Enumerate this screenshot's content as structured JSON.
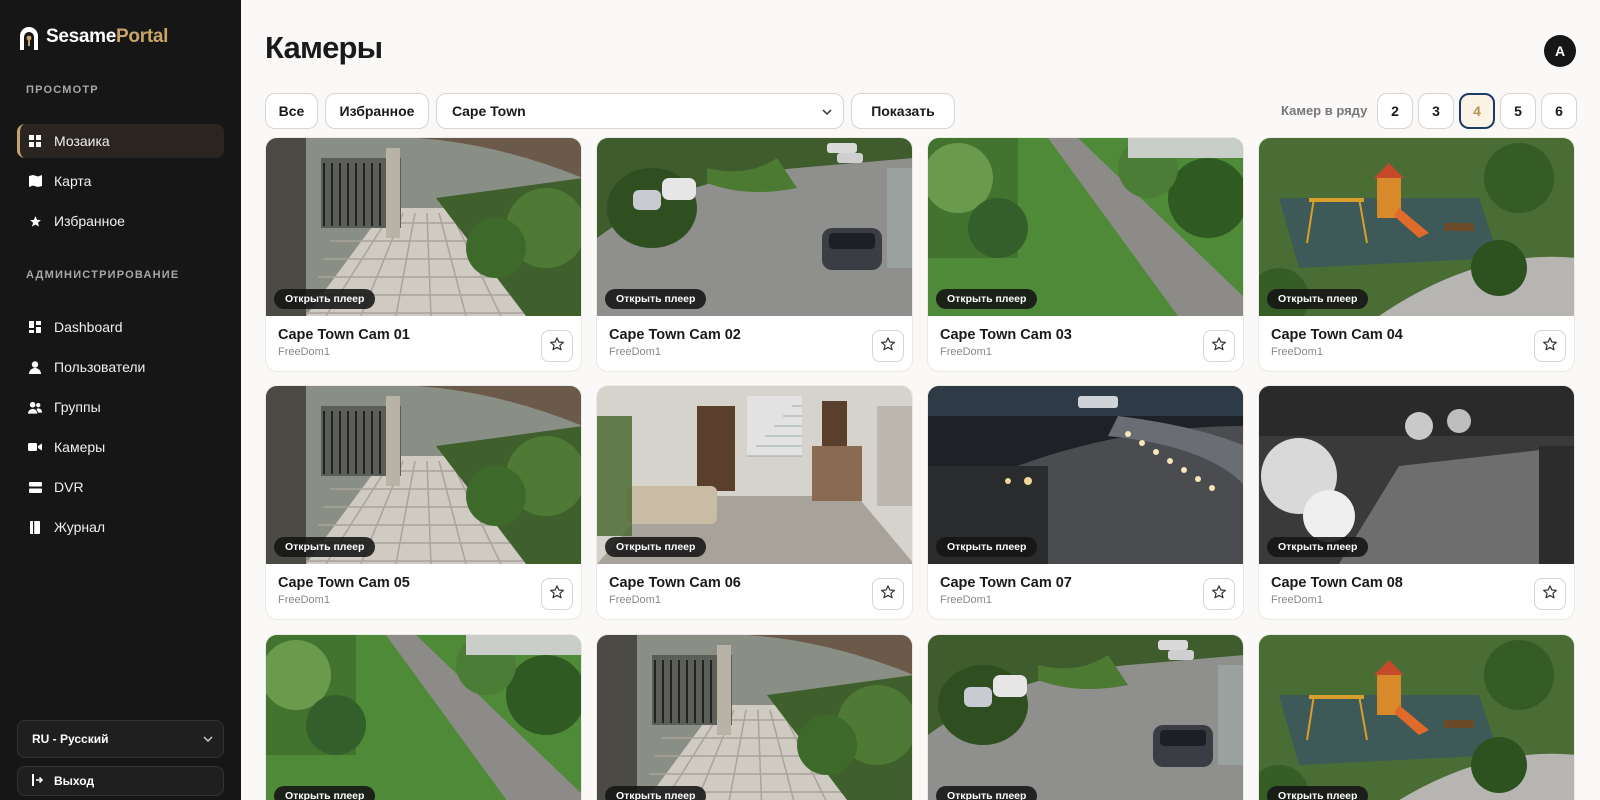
{
  "app": {
    "logo_part1": "Sesame",
    "logo_part2": "Portal"
  },
  "sidebar": {
    "view_section": "ПРОСМОТР",
    "view_items": [
      {
        "label": "Мозаика",
        "icon": "grid-icon",
        "active": true
      },
      {
        "label": "Карта",
        "icon": "map-icon",
        "active": false
      },
      {
        "label": "Избранное",
        "icon": "star-icon",
        "active": false
      }
    ],
    "admin_section": "АДМИНИСТРИРОВАНИЕ",
    "admin_items": [
      {
        "label": "Dashboard",
        "icon": "dashboard-icon"
      },
      {
        "label": "Пользователи",
        "icon": "user-icon"
      },
      {
        "label": "Группы",
        "icon": "users-icon"
      },
      {
        "label": "Камеры",
        "icon": "camera-icon"
      },
      {
        "label": "DVR",
        "icon": "dvr-icon"
      },
      {
        "label": "Журнал",
        "icon": "journal-icon"
      }
    ],
    "language": "RU - Русский",
    "logout": "Выход"
  },
  "header": {
    "title": "Камеры",
    "avatar_letter": "A"
  },
  "filters": {
    "all_label": "Все",
    "favorites_label": "Избранное",
    "city_selected": "Cape Town",
    "show_label": "Показать",
    "per_row_label": "Камер в ряду",
    "per_row_options": [
      "2",
      "3",
      "4",
      "5",
      "6"
    ],
    "per_row_selected": "4"
  },
  "cameras": {
    "open_player_label": "Открыть плеер",
    "items": [
      {
        "name": "Cape Town Cam 01",
        "owner": "FreeDom1",
        "scene": "gate"
      },
      {
        "name": "Cape Town Cam 02",
        "owner": "FreeDom1",
        "scene": "parking"
      },
      {
        "name": "Cape Town Cam 03",
        "owner": "FreeDom1",
        "scene": "path"
      },
      {
        "name": "Cape Town Cam 04",
        "owner": "FreeDom1",
        "scene": "playground"
      },
      {
        "name": "Cape Town Cam 05",
        "owner": "FreeDom1",
        "scene": "gate"
      },
      {
        "name": "Cape Town Cam 06",
        "owner": "FreeDom1",
        "scene": "lobby"
      },
      {
        "name": "Cape Town Cam 07",
        "owner": "FreeDom1",
        "scene": "night"
      },
      {
        "name": "Cape Town Cam 08",
        "owner": "FreeDom1",
        "scene": "ir"
      },
      {
        "name": "",
        "owner": "",
        "scene": "path"
      },
      {
        "name": "",
        "owner": "",
        "scene": "gate"
      },
      {
        "name": "",
        "owner": "",
        "scene": "parking"
      },
      {
        "name": "",
        "owner": "",
        "scene": "playground"
      }
    ]
  },
  "colors": {
    "accent": "#c9a46a",
    "sidebar_bg": "#161616",
    "page_bg": "#fbf9f7",
    "active_border": "#1d3a66"
  }
}
